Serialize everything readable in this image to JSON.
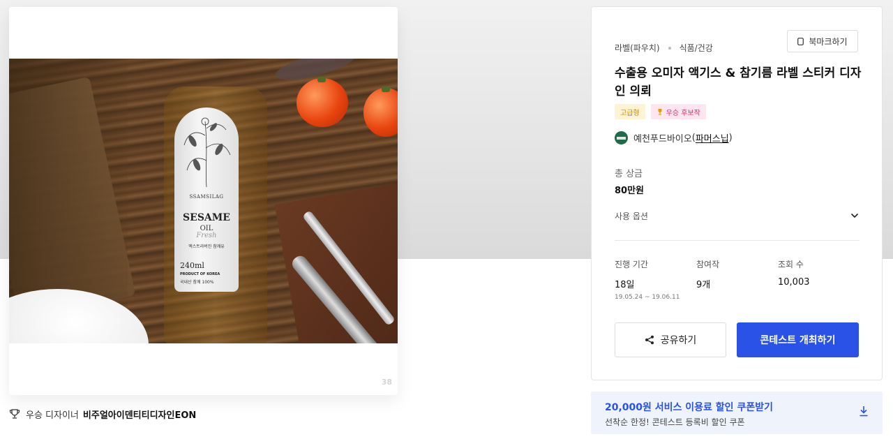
{
  "product_image": {
    "bottle": {
      "brand": "SSAMSILAG",
      "name": "SESAME",
      "oil": "OIL",
      "fresh": "Fresh",
      "korean_text": "엑스트라버진 참깨유",
      "volume": "240ml",
      "origin": "PRODUCT OF KOREA",
      "percent": "국내산 참깨 100%"
    },
    "counter": "38"
  },
  "winner": {
    "prefix": "우승 디자이너",
    "designer": "비주얼아이덴티티디자인EON"
  },
  "panel": {
    "category": "라벨(파우치)",
    "subcategory": "식품/건강",
    "bookmark_label": "북마크하기",
    "title": "수출용 오미자 액기스 & 참기름 라벨 스티커 디자인 의뢰",
    "badges": {
      "premium": "고급형",
      "excellent": "우승 후보작"
    },
    "host": {
      "name": "예천푸드바이오",
      "paren_open": "(",
      "member": "파머스닙",
      "paren_close": ")"
    },
    "prize": {
      "label": "총 상금",
      "value": "80만원"
    },
    "usage_label": "사용 옵션",
    "stats": {
      "period_label": "진행 기간",
      "period_value": "18일",
      "period_range": "19.05.24 ~ 19.06.11",
      "entries_label": "참여작",
      "entries_value": "9개",
      "views_label": "조회 수",
      "views_value": "10,003"
    },
    "share_label": "공유하기",
    "host_contest_label": "콘테스트 개최하기"
  },
  "coupon": {
    "title": "20,000원 서비스 이용료 할인 쿠폰받기",
    "subtitle": "선착순 한정! 콘테스트 등록비 할인 쿠폰"
  },
  "colors": {
    "primary": "#2a52e6",
    "premium_text": "#c68a00",
    "premium_bg": "#fff3d6",
    "excellent_text": "#d4306b",
    "excellent_bg": "#ffe5ef",
    "coupon_bg": "#eef3fc"
  },
  "icons": {
    "trophy": "trophy-icon",
    "bookmark": "bookmark-icon",
    "chevron": "chevron-down-icon",
    "share": "share-icon",
    "download": "download-icon"
  }
}
